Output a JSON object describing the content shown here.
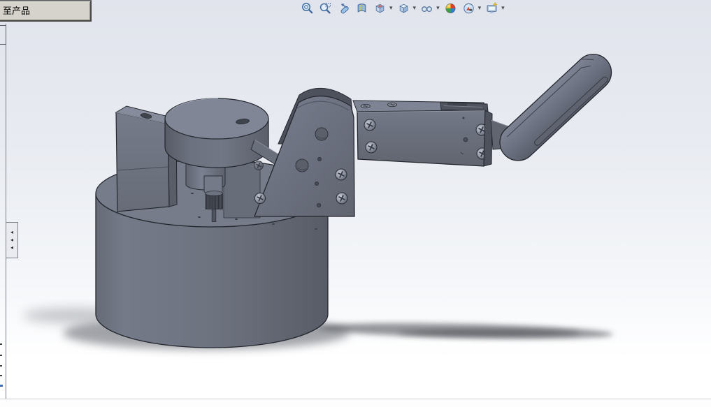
{
  "window": {
    "document_tab": {
      "label": "至产品"
    },
    "model": {
      "description": "robotic-arm-assembly-3d-model",
      "part_color": "#6e7380",
      "part_color_dark": "#585c66",
      "part_color_light": "#848a99",
      "outline_color": "#262931",
      "shadow_color": "#3f434b"
    },
    "background": {
      "top": "#e1e4ec",
      "bottom": "#ffffff"
    }
  },
  "toolbar": {
    "dropdown_glyph": "▾",
    "buttons": [
      {
        "id": "zoom-to-fit",
        "dropdown": false
      },
      {
        "id": "zoom-to-area",
        "dropdown": false
      },
      {
        "id": "previous-view",
        "dropdown": false
      },
      {
        "id": "section-view",
        "dropdown": false
      },
      {
        "id": "view-orientation",
        "dropdown": true
      },
      {
        "id": "display-style",
        "dropdown": true
      },
      {
        "id": "hide-show-items",
        "dropdown": true
      },
      {
        "id": "edit-appearance",
        "dropdown": false
      },
      {
        "id": "apply-scene",
        "dropdown": true
      },
      {
        "id": "view-settings",
        "dropdown": true
      }
    ]
  },
  "left_panel": {
    "collapsed": true,
    "expand_arrows": [
      "◂",
      "◂",
      "◂"
    ]
  }
}
